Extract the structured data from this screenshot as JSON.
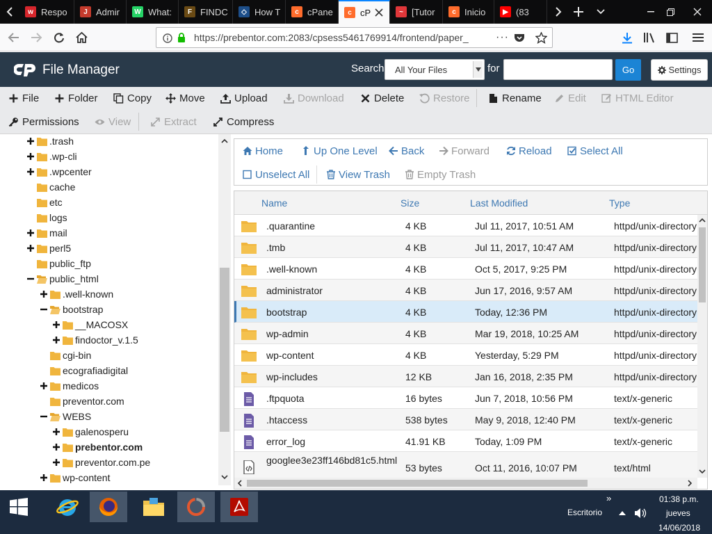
{
  "browser": {
    "tabs": [
      {
        "title": "Respo",
        "icon": "wp-icon",
        "color": "#d7262c",
        "glyph": "w"
      },
      {
        "title": "Admir",
        "icon": "joomla-admin-icon",
        "color": "#c43b2d",
        "glyph": "J"
      },
      {
        "title": "What:",
        "icon": "whatsapp-icon",
        "color": "#25d366",
        "glyph": "W"
      },
      {
        "title": "FINDC",
        "icon": "findoctor-icon",
        "color": "#6a4a14",
        "glyph": "F"
      },
      {
        "title": "How T",
        "icon": "howto-icon",
        "color": "#1d4e89",
        "glyph": "◇"
      },
      {
        "title": "cPane",
        "icon": "cpanel-icon",
        "color": "#ff6c2c",
        "glyph": "c"
      },
      {
        "title": "cP",
        "icon": "cpanel-icon",
        "color": "#ff6c2c",
        "glyph": "c",
        "active": true
      },
      {
        "title": "[Tutor",
        "icon": "tutorial-icon",
        "color": "#e0373a",
        "glyph": "~"
      },
      {
        "title": "Inicio",
        "icon": "cpanel-icon",
        "color": "#ff6c2c",
        "glyph": "c"
      },
      {
        "title": "(83",
        "icon": "youtube-icon",
        "color": "#ff0000",
        "glyph": "▶"
      }
    ],
    "url": "https://prebentor.com:2083/cpsess5461769914/frontend/paper_"
  },
  "header": {
    "title": "File Manager",
    "search_label": "Search",
    "search_scope": "All Your Files",
    "for_label": "for",
    "go_label": "Go",
    "settings_label": "Settings",
    "accent": "#1b84d5",
    "bg": "#293a4a"
  },
  "toolbar": {
    "file": "File",
    "folder": "Folder",
    "copy": "Copy",
    "move": "Move",
    "upload": "Upload",
    "download": "Download",
    "delete": "Delete",
    "restore": "Restore",
    "rename": "Rename",
    "edit": "Edit",
    "html_editor": "HTML Editor",
    "permissions": "Permissions",
    "view": "View",
    "extract": "Extract",
    "compress": "Compress"
  },
  "tree": [
    {
      "label": ".trash",
      "toggle": "plus",
      "indent": 0
    },
    {
      "label": ".wp-cli",
      "toggle": "plus",
      "indent": 0
    },
    {
      "label": ".wpcenter",
      "toggle": "plus",
      "indent": 0
    },
    {
      "label": "cache",
      "toggle": "none",
      "indent": 0
    },
    {
      "label": "etc",
      "toggle": "none",
      "indent": 0
    },
    {
      "label": "logs",
      "toggle": "none",
      "indent": 0
    },
    {
      "label": "mail",
      "toggle": "plus",
      "indent": 0
    },
    {
      "label": "perl5",
      "toggle": "plus",
      "indent": 0
    },
    {
      "label": "public_ftp",
      "toggle": "none",
      "indent": 0
    },
    {
      "label": "public_html",
      "toggle": "minus",
      "indent": 0,
      "open": true
    },
    {
      "label": ".well-known",
      "toggle": "plus",
      "indent": 1
    },
    {
      "label": "bootstrap",
      "toggle": "minus",
      "indent": 1,
      "open": true
    },
    {
      "label": "__MACOSX",
      "toggle": "plus",
      "indent": 2
    },
    {
      "label": "findoctor_v.1.5",
      "toggle": "plus",
      "indent": 2
    },
    {
      "label": "cgi-bin",
      "toggle": "none",
      "indent": 1
    },
    {
      "label": "ecografiadigital",
      "toggle": "none",
      "indent": 1
    },
    {
      "label": "medicos",
      "toggle": "plus",
      "indent": 1
    },
    {
      "label": "preventor.com",
      "toggle": "none",
      "indent": 1
    },
    {
      "label": "WEBS",
      "toggle": "minus",
      "indent": 1,
      "open": true
    },
    {
      "label": "galenosperu",
      "toggle": "plus",
      "indent": 2
    },
    {
      "label": "prebentor.com",
      "toggle": "plus",
      "indent": 2,
      "bold": true
    },
    {
      "label": "preventor.com.pe",
      "toggle": "plus",
      "indent": 2
    },
    {
      "label": "wp-content",
      "toggle": "plus",
      "indent": 1
    }
  ],
  "actions": {
    "home": "Home",
    "up": "Up One Level",
    "back": "Back",
    "forward": "Forward",
    "reload": "Reload",
    "select_all": "Select All",
    "unselect_all": "Unselect All",
    "view_trash": "View Trash",
    "empty_trash": "Empty Trash"
  },
  "columns": {
    "name": "Name",
    "size": "Size",
    "modified": "Last Modified",
    "type": "Type"
  },
  "files": [
    {
      "name": ".quarantine",
      "size": "4 KB",
      "modified": "Jul 11, 2017, 10:51 AM",
      "type": "httpd/unix-directory",
      "kind": "folder"
    },
    {
      "name": ".tmb",
      "size": "4 KB",
      "modified": "Jul 11, 2017, 10:47 AM",
      "type": "httpd/unix-directory",
      "kind": "folder"
    },
    {
      "name": ".well-known",
      "size": "4 KB",
      "modified": "Oct 5, 2017, 9:25 PM",
      "type": "httpd/unix-directory",
      "kind": "folder"
    },
    {
      "name": "administrator",
      "size": "4 KB",
      "modified": "Jun 17, 2016, 9:57 AM",
      "type": "httpd/unix-directory",
      "kind": "folder"
    },
    {
      "name": "bootstrap",
      "size": "4 KB",
      "modified": "Today, 12:36 PM",
      "type": "httpd/unix-directory",
      "kind": "folder",
      "selected": true
    },
    {
      "name": "wp-admin",
      "size": "4 KB",
      "modified": "Mar 19, 2018, 10:25 AM",
      "type": "httpd/unix-directory",
      "kind": "folder"
    },
    {
      "name": "wp-content",
      "size": "4 KB",
      "modified": "Yesterday, 5:29 PM",
      "type": "httpd/unix-directory",
      "kind": "folder"
    },
    {
      "name": "wp-includes",
      "size": "12 KB",
      "modified": "Jan 16, 2018, 2:35 PM",
      "type": "httpd/unix-directory",
      "kind": "folder"
    },
    {
      "name": ".ftpquota",
      "size": "16 bytes",
      "modified": "Jun 7, 2018, 10:56 PM",
      "type": "text/x-generic",
      "kind": "text"
    },
    {
      "name": ".htaccess",
      "size": "538 bytes",
      "modified": "May 9, 2018, 12:40 PM",
      "type": "text/x-generic",
      "kind": "text"
    },
    {
      "name": "error_log",
      "size": "41.91 KB",
      "modified": "Today, 1:09 PM",
      "type": "text/x-generic",
      "kind": "text"
    },
    {
      "name": "googlee3e23ff146bd81c5.html",
      "size": "53 bytes",
      "modified": "Oct 11, 2016, 10:07 PM",
      "type": "text/html",
      "kind": "html"
    }
  ],
  "taskbar": {
    "desktop_label": "Escritorio",
    "time": "01:38 p.m.",
    "day": "jueves",
    "date": "14/06/2018",
    "overflow": "»"
  }
}
